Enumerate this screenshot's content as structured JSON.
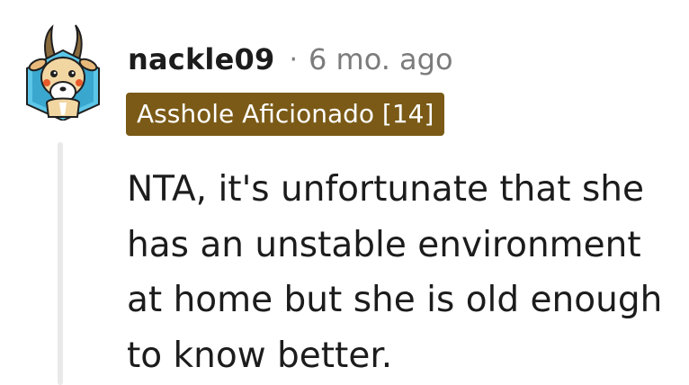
{
  "comment": {
    "username": "nackle09",
    "separator": "·",
    "timestamp": "6 mo. ago",
    "flair": "Asshole Aficionado [14]",
    "body": "NTA, it's unfortunate that she has an unstable environment at home but she is old enough to know better."
  },
  "colors": {
    "flair_background": "#7a5a16",
    "flair_text": "#ffffff",
    "meta_text": "#7c7c7c",
    "thread_line": "#e9e9e9"
  },
  "icons": {
    "avatar": "goat-avatar-icon"
  }
}
